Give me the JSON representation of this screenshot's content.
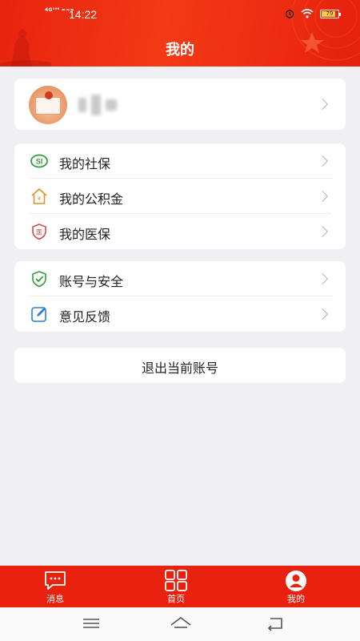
{
  "status_bar": {
    "network": "4G¹⁶⁶ ≈≈≈",
    "time": "14:22",
    "battery": "79"
  },
  "header": {
    "title": "我的"
  },
  "profile": {
    "name": ""
  },
  "menu_group_1": [
    {
      "label": "我的社保",
      "icon": "social-security-icon",
      "color": "#2e9e3b"
    },
    {
      "label": "我的公积金",
      "icon": "house-fund-icon",
      "color": "#d9962b"
    },
    {
      "label": "我的医保",
      "icon": "medical-insurance-icon",
      "color": "#d14a4a"
    }
  ],
  "menu_group_2": [
    {
      "label": "账号与安全",
      "icon": "shield-check-icon",
      "color": "#2e9e3b"
    },
    {
      "label": "意见反馈",
      "icon": "edit-icon",
      "color": "#2f7fd6"
    }
  ],
  "logout": {
    "label": "退出当前账号"
  },
  "tabbar": {
    "tabs": [
      {
        "label": "消息",
        "icon": "message-icon"
      },
      {
        "label": "首页",
        "icon": "grid-home-icon"
      },
      {
        "label": "我的",
        "icon": "person-icon",
        "active": true
      }
    ],
    "background": "#e8220f"
  },
  "colors": {
    "brand": "#e8220f",
    "page_bg": "#efeff4"
  }
}
